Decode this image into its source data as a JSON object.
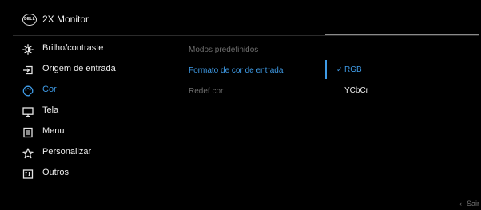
{
  "header": {
    "logo_text": "DELL",
    "title": "2X Monitor"
  },
  "sidebar": {
    "items": [
      {
        "label": "Brilho/contraste",
        "icon": "brightness-icon",
        "active": false
      },
      {
        "label": "Origem de entrada",
        "icon": "input-source-icon",
        "active": false
      },
      {
        "label": "Cor",
        "icon": "color-palette-icon",
        "active": true
      },
      {
        "label": "Tela",
        "icon": "display-icon",
        "active": false
      },
      {
        "label": "Menu",
        "icon": "menu-icon",
        "active": false
      },
      {
        "label": "Personalizar",
        "icon": "star-icon",
        "active": false
      },
      {
        "label": "Outros",
        "icon": "others-icon",
        "active": false
      }
    ]
  },
  "submenu": {
    "items": [
      {
        "label": "Modos predefinidos",
        "state": "dim"
      },
      {
        "label": "Formato de cor de entrada",
        "state": "selected"
      },
      {
        "label": "Redef cor",
        "state": "dim"
      }
    ]
  },
  "values": {
    "options": [
      {
        "label": "RGB",
        "checked": true
      },
      {
        "label": "YCbCr",
        "checked": false
      }
    ],
    "check_glyph": "✓"
  },
  "footer": {
    "exit_label": "Sair",
    "exit_icon": "chevron-left-icon"
  },
  "colors": {
    "accent": "#3f9be6",
    "background": "#000000",
    "text": "#ececec",
    "dim_text": "#6e6e6e"
  }
}
